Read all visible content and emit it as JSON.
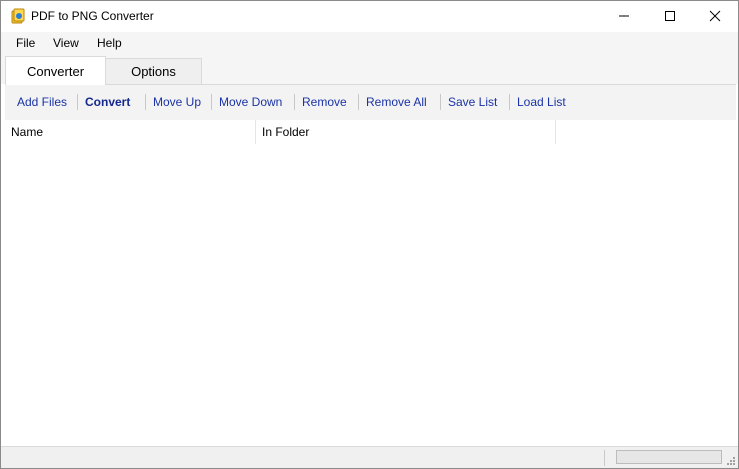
{
  "window": {
    "title": "PDF to PNG Converter",
    "minimize_icon": "minimize-icon",
    "maximize_icon": "maximize-icon",
    "close_icon": "close-icon"
  },
  "menu": {
    "file": "File",
    "view": "View",
    "help": "Help"
  },
  "tabs": [
    {
      "label": "Converter",
      "active": true
    },
    {
      "label": "Options",
      "active": false
    }
  ],
  "toolbar": {
    "add_files": "Add Files",
    "convert": "Convert",
    "move_up": "Move Up",
    "move_down": "Move Down",
    "remove": "Remove",
    "remove_all": "Remove All",
    "save_list": "Save List",
    "load_list": "Load List"
  },
  "list": {
    "columns": [
      "Name",
      "In Folder"
    ],
    "rows": []
  },
  "status": {
    "progress_fraction": 0
  },
  "colors": {
    "toolbar_link": "#1a33a6",
    "menubar_bg": "#f5f5f5",
    "toolbar_bg": "#f3f3f3",
    "border": "#dadada"
  }
}
